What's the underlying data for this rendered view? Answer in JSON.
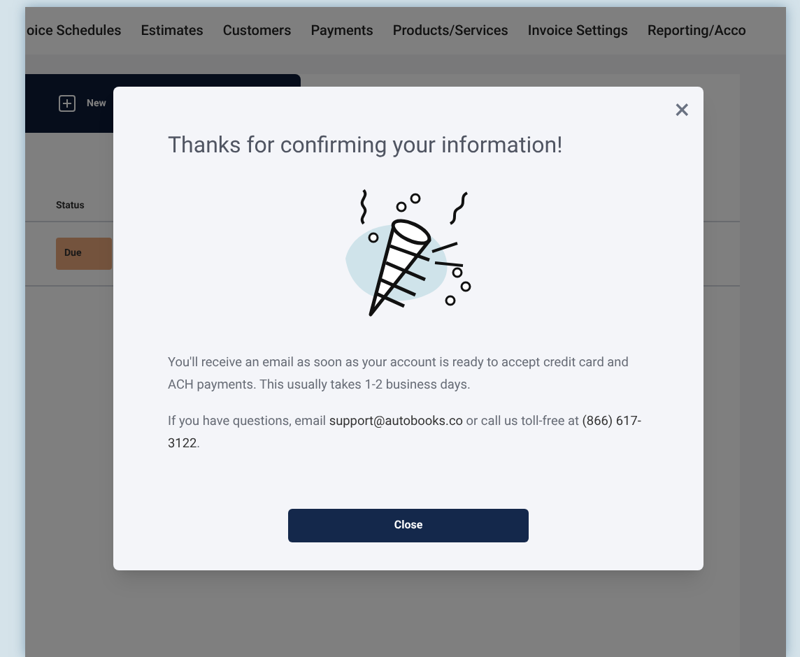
{
  "nav": {
    "items": [
      "oice Schedules",
      "Estimates",
      "Customers",
      "Payments",
      "Products/Services",
      "Invoice Settings",
      "Reporting/Acco"
    ]
  },
  "toolbar": {
    "new_button": "New"
  },
  "table": {
    "columns": [
      "Status"
    ],
    "rows": [
      {
        "status": "Due"
      }
    ]
  },
  "modal": {
    "title": "Thanks for confirming your information!",
    "close_icon": "×",
    "paragraphs": [
      {
        "parts": [
          {
            "kind": "text",
            "text": "You'll receive an email as soon as your account is ready to accept credit card and ACH payments. This usually takes 1-2 business days."
          }
        ]
      },
      {
        "parts": [
          {
            "kind": "text",
            "text": "If you have questions, email "
          },
          {
            "kind": "link",
            "text": "support@autobooks.co"
          },
          {
            "kind": "text",
            "text": " or call us toll-free at "
          },
          {
            "kind": "phone",
            "text": "(866) 617-3122"
          },
          {
            "kind": "text",
            "text": "."
          }
        ]
      }
    ],
    "button": "Close"
  }
}
